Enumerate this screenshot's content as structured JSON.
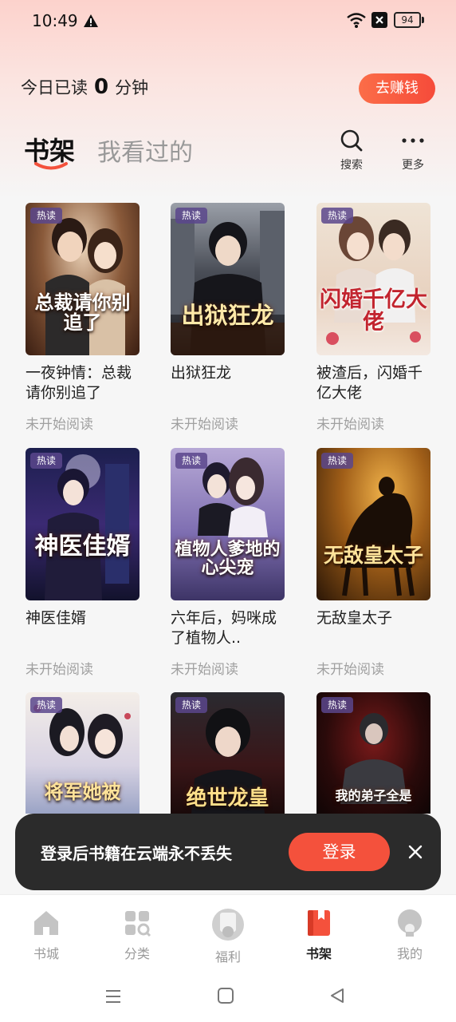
{
  "status_bar": {
    "time": "10:49",
    "battery": "94"
  },
  "header": {
    "read_prefix": "今日已读",
    "read_minutes": "0",
    "read_suffix": "分钟",
    "earn_button": "去赚钱"
  },
  "tabs": {
    "shelf": "书架",
    "history": "我看过的"
  },
  "tools": {
    "search": "搜索",
    "more": "更多"
  },
  "books": [
    {
      "badge": "热读",
      "cover_text": "总裁请你别追了",
      "title": "一夜钟情：总裁请你别追了",
      "status": "未开始阅读"
    },
    {
      "badge": "热读",
      "cover_text": "出狱狂龙",
      "title": "出狱狂龙",
      "status": "未开始阅读"
    },
    {
      "badge": "热读",
      "cover_text": "闪婚千亿大佬",
      "title": "被渣后，闪婚千亿大佬",
      "status": "未开始阅读"
    },
    {
      "badge": "热读",
      "cover_text": "神医佳婿",
      "title": "神医佳婿",
      "status": "未开始阅读"
    },
    {
      "badge": "热读",
      "cover_text": "植物人爹地的心尖宠",
      "title": "六年后，妈咪成了植物人..",
      "status": "未开始阅读"
    },
    {
      "badge": "热读",
      "cover_text": "无敌皇太子",
      "title": "无敌皇太子",
      "status": "未开始阅读"
    },
    {
      "badge": "热读",
      "cover_text": "将军她被",
      "title": "",
      "status": ""
    },
    {
      "badge": "热读",
      "cover_text": "绝世龙皇",
      "title": "",
      "status": ""
    },
    {
      "badge": "热读",
      "cover_text": "我的弟子全是",
      "title": "",
      "status": ""
    }
  ],
  "login_banner": {
    "text": "登录后书籍在云端永不丢失",
    "button": "登录"
  },
  "bottom_nav": [
    {
      "label": "书城",
      "icon": "home-icon"
    },
    {
      "label": "分类",
      "icon": "category-icon"
    },
    {
      "label": "福利",
      "icon": "gift-icon"
    },
    {
      "label": "书架",
      "icon": "bookshelf-icon",
      "active": true
    },
    {
      "label": "我的",
      "icon": "profile-icon"
    }
  ],
  "colors": {
    "accent": "#f4513c",
    "banner_bg": "#2b2b2b",
    "muted_text": "#a0a0a0"
  }
}
